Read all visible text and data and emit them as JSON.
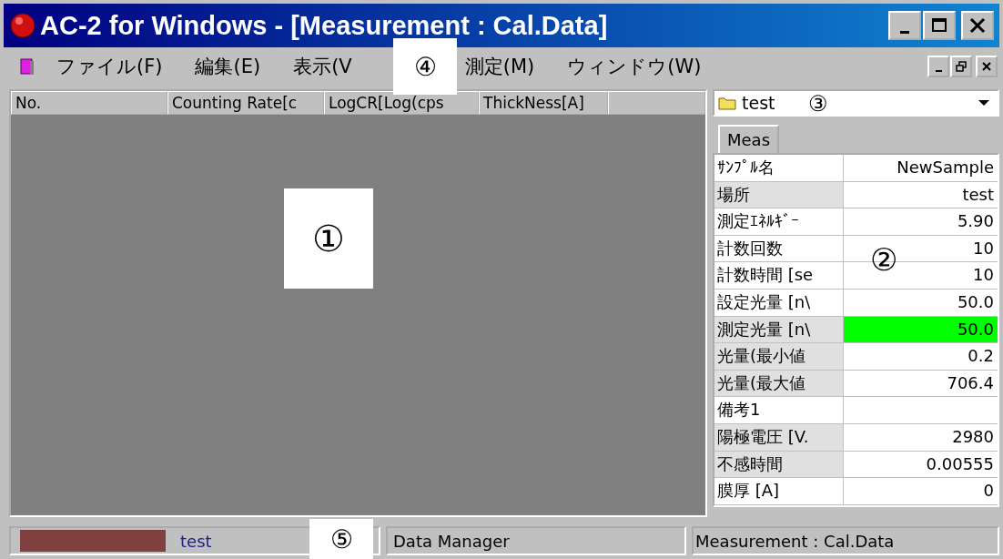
{
  "window": {
    "title": "AC-2 for Windows - [Measurement : Cal.Data]"
  },
  "menu": [
    {
      "label": "ファイル(F)"
    },
    {
      "label": "編集(E)"
    },
    {
      "label": "表示(V"
    },
    {
      "label": "測定(M)"
    },
    {
      "label": "ウィンドウ(W)"
    }
  ],
  "table": {
    "columns": [
      "No.",
      "Counting Rate[c",
      "LogCR[Log(cps",
      "ThickNess[A]"
    ]
  },
  "folder": {
    "value": "test"
  },
  "tabs": [
    {
      "label": "Meas",
      "selected": true
    }
  ],
  "properties": [
    {
      "label": "ｻﾝﾌﾟﾙ名",
      "value": "NewSample",
      "shaded": false,
      "highlight": false
    },
    {
      "label": "場所",
      "value": "test",
      "shaded": true,
      "highlight": false
    },
    {
      "label": "測定ｴﾈﾙｷﾞｰ",
      "value": "5.90",
      "shaded": false,
      "highlight": false
    },
    {
      "label": "計数回数",
      "value": "10",
      "shaded": false,
      "highlight": false
    },
    {
      "label": "計数時間 [se",
      "value": "10",
      "shaded": false,
      "highlight": false
    },
    {
      "label": "設定光量 [n\\",
      "value": "50.0",
      "shaded": false,
      "highlight": false
    },
    {
      "label": "測定光量 [n\\",
      "value": "50.0",
      "shaded": true,
      "highlight": true
    },
    {
      "label": "光量(最小値",
      "value": "0.2",
      "shaded": true,
      "highlight": false
    },
    {
      "label": "光量(最大値",
      "value": "706.4",
      "shaded": true,
      "highlight": false
    },
    {
      "label": "備考1",
      "shaded": false,
      "highlight": false
    },
    {
      "label": "陽極電圧 [V.",
      "value": "2980",
      "shaded": true,
      "highlight": false
    },
    {
      "label": "不感時間",
      "value": "0.00555",
      "shaded": true,
      "highlight": false
    },
    {
      "label": "膜厚 [A]",
      "value": "0",
      "shaded": false,
      "highlight": false
    }
  ],
  "status_bar": {
    "user": "test",
    "module": "Data Manager",
    "window": "Measurement : Cal.Data"
  },
  "annotations": [
    {
      "label": "①"
    },
    {
      "label": "②"
    },
    {
      "label": "③"
    },
    {
      "label": "④"
    },
    {
      "label": "⑤"
    }
  ]
}
